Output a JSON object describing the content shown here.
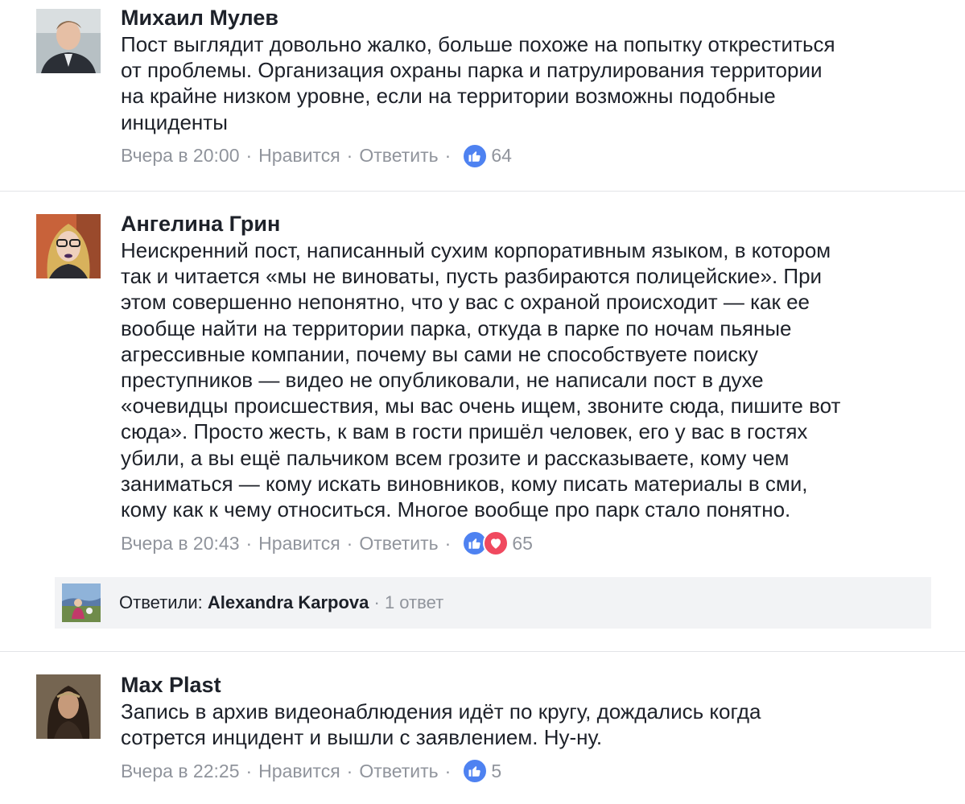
{
  "comments": [
    {
      "author": "Михаил Мулев",
      "lines": [
        "Пост выглядит довольно жалко, больше похоже на попытку откреститься",
        "от проблемы. Организация охраны парка и патрулирования территории",
        "на крайне низком уровне, если на территории возможны подобные",
        "инциденты"
      ],
      "time": "Вчера в 20:00",
      "like": "Нравится",
      "reply": "Ответить",
      "reactions": [
        "like-icon"
      ],
      "count": "64"
    },
    {
      "author": "Ангелина Грин",
      "lines": [
        "Неискренний пост, написанный сухим корпоративным языком, в котором",
        "так и читается «мы не виноваты, пусть разбираются полицейские». При",
        "этом совершенно непонятно, что у вас с охраной происходит — как ее",
        "вообще найти на территории парка, откуда в парке по ночам пьяные",
        "агрессивные компании, почему вы сами не способствуете поиску",
        "преступников — видео не опубликовали, не написали пост в духе",
        "«очевидцы происшествия, мы вас очень ищем, звоните сюда, пишите вот",
        "сюда». Просто жесть, к вам в гости пришёл человек, его у вас в гостях",
        "убили, а вы ещё пальчиком всем грозите и рассказываете, кому чем",
        "заниматься — кому искать виновников, кому писать материалы в сми,",
        "кому как к чему относиться. Многое вообще про парк стало понятно."
      ],
      "time": "Вчера в 20:43",
      "like": "Нравится",
      "reply": "Ответить",
      "reactions": [
        "like-icon",
        "heart-icon"
      ],
      "count": "65"
    },
    {
      "author": "Max Plast",
      "lines": [
        "Запись в архив видеонаблюдения идёт по кругу, дождались когда",
        "сотрется инцидент и вышли с заявлением. Ну-ну."
      ],
      "time": "Вчера в 22:25",
      "like": "Нравится",
      "reply": "Ответить",
      "reactions": [
        "like-icon"
      ],
      "count": "5"
    }
  ],
  "replies": {
    "prefix": "Ответили: ",
    "name": "Alexandra Karpova",
    "count": "1 ответ",
    "sep": " · "
  },
  "colors": {
    "meta_gray": "#90949c",
    "like_blue": "#4e82f1",
    "love_red": "#f0495f",
    "reply_bar_bg": "#f2f3f5"
  }
}
